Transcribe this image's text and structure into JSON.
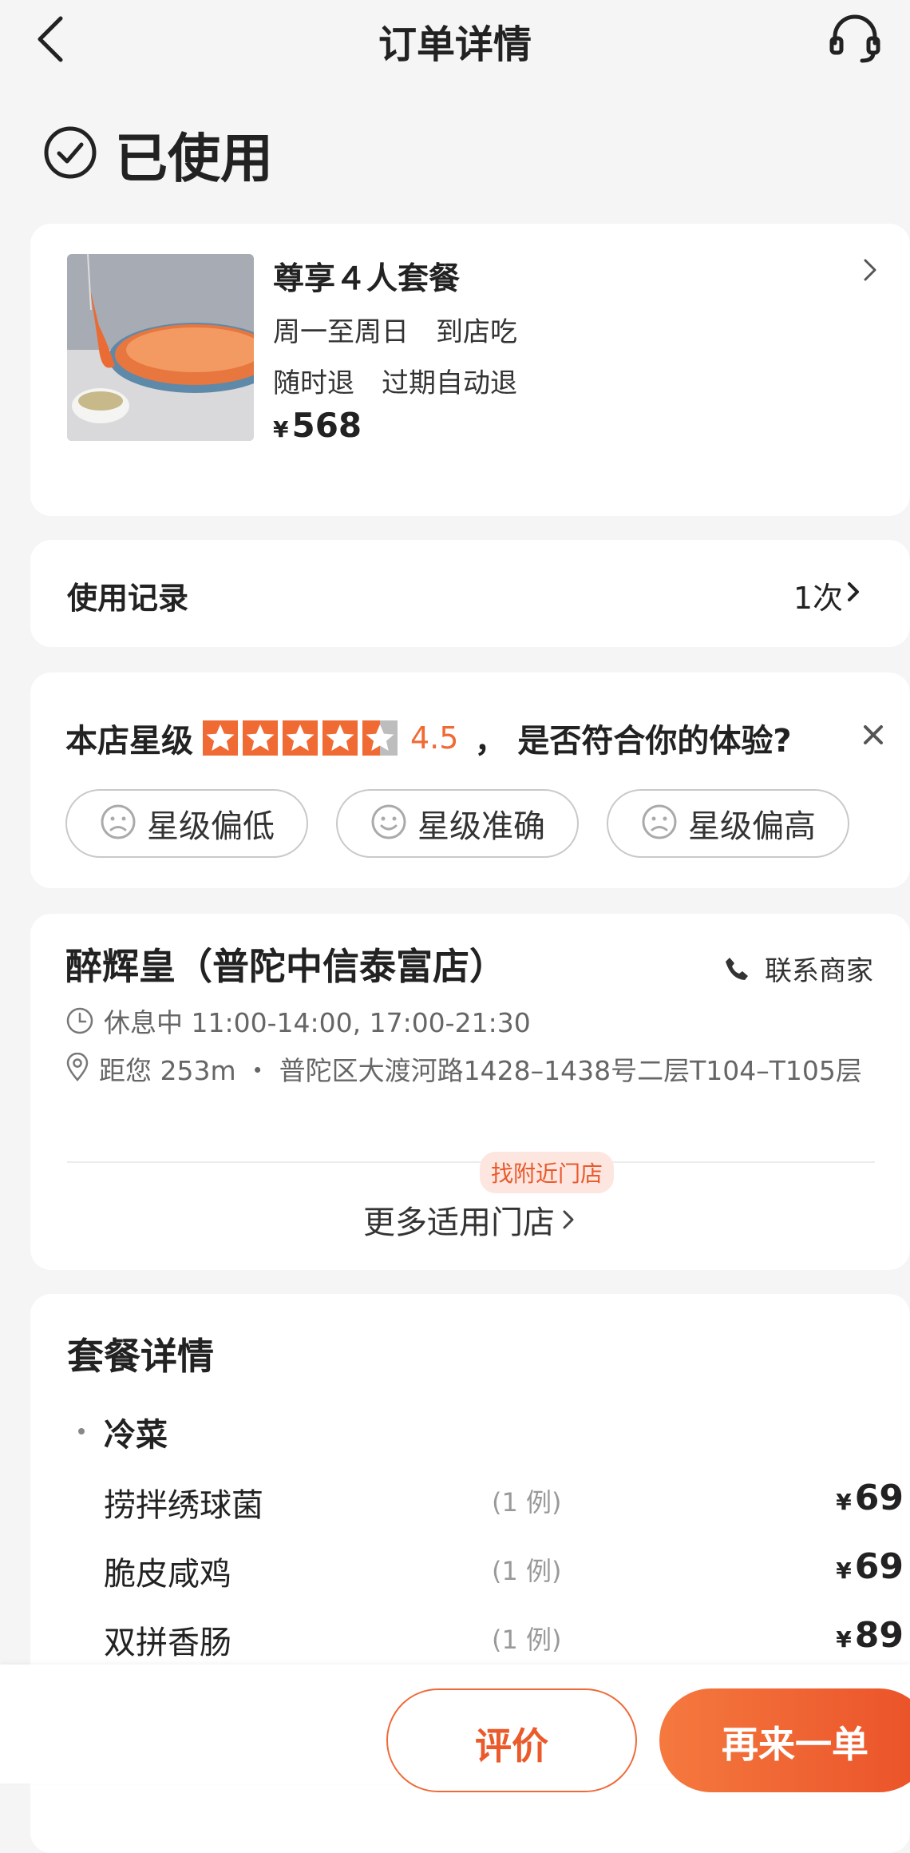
{
  "header": {
    "title": "订单详情",
    "back_icon": "back-arrow-icon",
    "service_icon": "headset-icon"
  },
  "status": {
    "text": "已使用",
    "icon": "check-circle-icon"
  },
  "product": {
    "name": "尊享４人套餐",
    "line1": "周一至周日　到店吃",
    "line2": "随时退　过期自动退",
    "currency": "¥",
    "price": "568"
  },
  "usage": {
    "label": "使用记录",
    "count": "1次"
  },
  "rating": {
    "label": "本店星级",
    "stars": 4.5,
    "score": "4.5",
    "question": "，  是否符合你的体验?",
    "accent_color": "#f06a34",
    "options": [
      {
        "label": "星级偏低",
        "icon": "frown-face-icon"
      },
      {
        "label": "星级准确",
        "icon": "smile-face-icon"
      },
      {
        "label": "星级偏高",
        "icon": "frown-face-icon"
      }
    ]
  },
  "store": {
    "name": "醉辉皇（普陀中信泰富店）",
    "contact_label": "联系商家",
    "hours": "休息中 11:00-14:00, 17:00-21:30",
    "address": "距您 253m ・ 普陀区大渡河路1428–1438号二层T104–T105层",
    "nearby_badge": "找附近门店",
    "more_stores": "更多适用门店"
  },
  "package": {
    "title": "套餐详情",
    "category": "冷菜",
    "items": [
      {
        "name": "捞拌绣球菌",
        "qty": "(1 例)",
        "currency": "¥",
        "price": "69"
      },
      {
        "name": "脆皮咸鸡",
        "qty": "(1 例)",
        "currency": "¥",
        "price": "69"
      },
      {
        "name": "双拼香肠",
        "qty": "(1 例)",
        "currency": "¥",
        "price": "89"
      }
    ]
  },
  "actions": {
    "review": "评价",
    "reorder": "再来一单"
  }
}
